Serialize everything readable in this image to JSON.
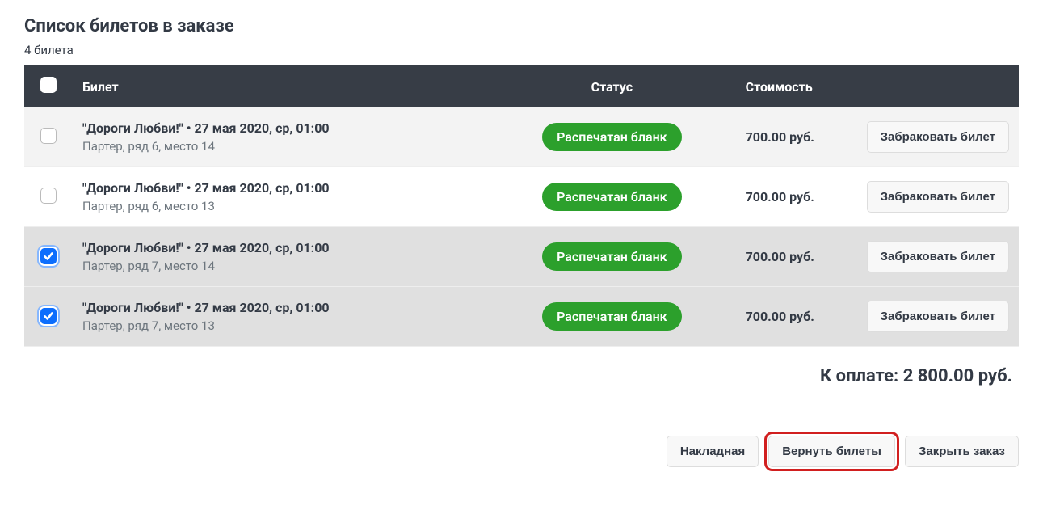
{
  "header": {
    "title": "Список билетов в заказе",
    "count_text": "4 билета"
  },
  "table": {
    "columns": {
      "ticket": "Билет",
      "status": "Статус",
      "price": "Стоимость",
      "action": ""
    },
    "rows": [
      {
        "checked": false,
        "title": "\"Дороги Любви!\" • 27 мая 2020, ср, 01:00",
        "seat": "Партер, ряд 6, место 14",
        "status": "Распечатан бланк",
        "price": "700.00 руб.",
        "action": "Забраковать билет"
      },
      {
        "checked": false,
        "title": "\"Дороги Любви!\" • 27 мая 2020, ср, 01:00",
        "seat": "Партер, ряд 6, место 13",
        "status": "Распечатан бланк",
        "price": "700.00 руб.",
        "action": "Забраковать билет"
      },
      {
        "checked": true,
        "title": "\"Дороги Любви!\" • 27 мая 2020, ср, 01:00",
        "seat": "Партер, ряд 7, место 14",
        "status": "Распечатан бланк",
        "price": "700.00 руб.",
        "action": "Забраковать билет"
      },
      {
        "checked": true,
        "title": "\"Дороги Любви!\" • 27 мая 2020, ср, 01:00",
        "seat": "Партер, ряд 7, место 13",
        "status": "Распечатан бланк",
        "price": "700.00 руб.",
        "action": "Забраковать билет"
      }
    ]
  },
  "total": {
    "label": "К оплате:",
    "value": "2 800.00 руб."
  },
  "footer": {
    "invoice": "Накладная",
    "return": "Вернуть билеты",
    "close": "Закрыть заказ"
  }
}
